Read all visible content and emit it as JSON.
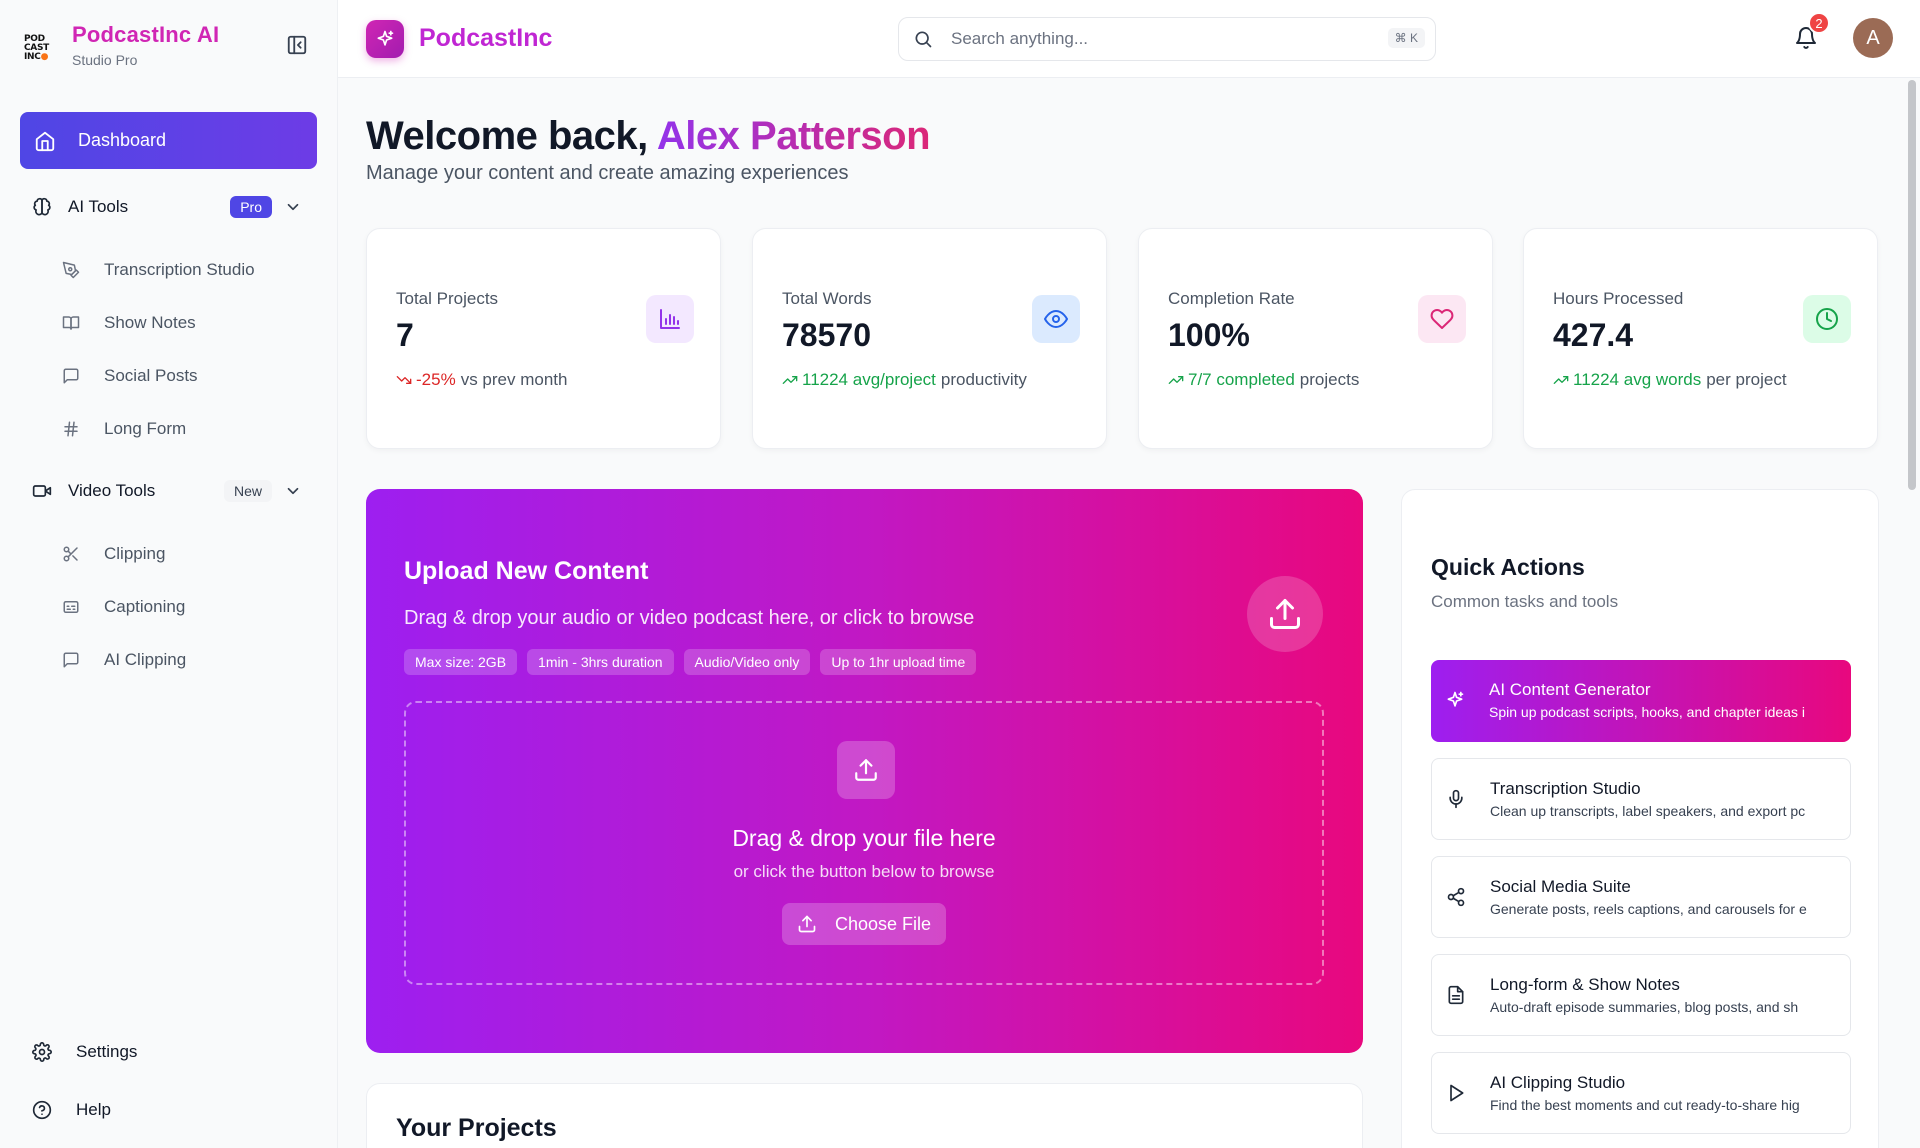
{
  "brand": {
    "logo_lines": [
      "POD",
      "CAST",
      "INC"
    ],
    "name": "PodcastInc AI",
    "subtitle": "Studio Pro"
  },
  "sidebar": {
    "active_item": {
      "label": "Dashboard",
      "icon": "home-icon"
    },
    "ai_tools": {
      "label": "AI Tools",
      "badge": "Pro",
      "icon": "brain-icon",
      "items": [
        {
          "label": "Transcription Studio",
          "icon": "pen-icon"
        },
        {
          "label": "Show Notes",
          "icon": "book-icon"
        },
        {
          "label": "Social Posts",
          "icon": "message-icon"
        },
        {
          "label": "Long Form",
          "icon": "hash-icon"
        }
      ]
    },
    "video_tools": {
      "label": "Video Tools",
      "badge": "New",
      "icon": "video-icon",
      "items": [
        {
          "label": "Clipping",
          "icon": "scissors-icon"
        },
        {
          "label": "Captioning",
          "icon": "captions-icon"
        },
        {
          "label": "AI Clipping",
          "icon": "message-icon"
        }
      ]
    },
    "bottom": [
      {
        "label": "Settings",
        "icon": "gear-icon"
      },
      {
        "label": "Help",
        "icon": "help-icon"
      }
    ]
  },
  "header": {
    "title": "PodcastInc",
    "search_placeholder": "Search anything...",
    "search_shortcut": "⌘ K",
    "notification_count": "2",
    "avatar_initial": "A"
  },
  "welcome": {
    "prefix": "Welcome back,",
    "name": "Alex Patterson",
    "subtitle": "Manage your content and create amazing experiences"
  },
  "stats": [
    {
      "label": "Total Projects",
      "value": "7",
      "highlight": "-25%",
      "suffix": "vs prev month",
      "trend": "down",
      "icon": "bar-chart-icon",
      "accent": "#9333ea",
      "icon_bg": "#f3e8ff"
    },
    {
      "label": "Total Words",
      "value": "78570",
      "highlight": "11224 avg/project",
      "suffix": "productivity",
      "trend": "up",
      "icon": "eye-icon",
      "accent": "#2563eb",
      "icon_bg": "#dbeafe"
    },
    {
      "label": "Completion Rate",
      "value": "100%",
      "highlight": "7/7 completed",
      "suffix": "projects",
      "trend": "up",
      "icon": "heart-icon",
      "accent": "#db2777",
      "icon_bg": "#fce7f3"
    },
    {
      "label": "Hours Processed",
      "value": "427.4",
      "highlight": "11224 avg words",
      "suffix": "per project",
      "trend": "up",
      "icon": "clock-icon",
      "accent": "#16a34a",
      "icon_bg": "#dcfce7"
    }
  ],
  "upload": {
    "title": "Upload New Content",
    "description": "Drag & drop your audio or video podcast here, or click to browse",
    "chips": [
      "Max size: 2GB",
      "1min - 3hrs duration",
      "Audio/Video only",
      "Up to 1hr upload time"
    ],
    "drop_title": "Drag & drop your file here",
    "drop_subtitle": "or click the button below to browse",
    "button_label": "Choose File"
  },
  "projects": {
    "title": "Your Projects"
  },
  "quick_actions": {
    "title": "Quick Actions",
    "subtitle": "Common tasks and tools",
    "items": [
      {
        "title": "AI Content Generator",
        "description": "Spin up podcast scripts, hooks, and chapter ideas i",
        "icon": "sparkles-icon",
        "active": true
      },
      {
        "title": "Transcription Studio",
        "description": "Clean up transcripts, label speakers, and export pc",
        "icon": "mic-icon"
      },
      {
        "title": "Social Media Suite",
        "description": "Generate posts, reels captions, and carousels for e",
        "icon": "share-icon"
      },
      {
        "title": "Long-form & Show Notes",
        "description": "Auto-draft episode summaries, blog posts, and sh",
        "icon": "document-icon"
      },
      {
        "title": "AI Clipping Studio",
        "description": "Find the best moments and cut ready-to-share hig",
        "icon": "play-icon"
      }
    ]
  },
  "colors": {
    "brand_pink": "#d026b4",
    "nav_active": "#4f46e5",
    "gradient_start": "#9d1ff0",
    "gradient_end": "#e8087e",
    "trend_up": "#16a34a",
    "trend_down": "#dc2626"
  }
}
